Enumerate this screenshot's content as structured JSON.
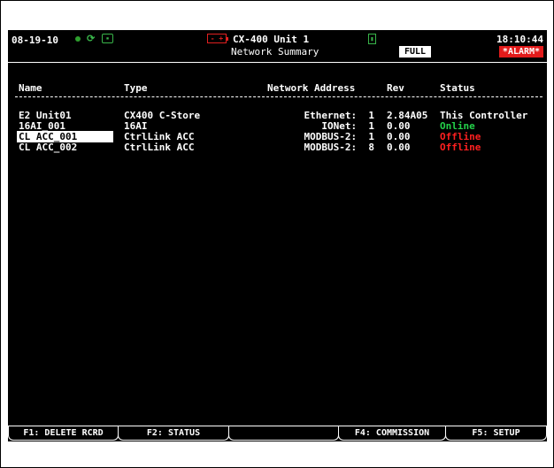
{
  "header": {
    "date": "08-19-10",
    "unit_title": "CX-400 Unit 1",
    "screen_title": "Network Summary",
    "time": "18:10:44",
    "mode_badge": "FULL",
    "alarm_badge": "*ALARM*",
    "icons": [
      "status-dot-icon",
      "network-icon",
      "module-icon",
      "battery-icon",
      "lock-icon"
    ]
  },
  "table": {
    "columns": [
      "Name",
      "Type",
      "Network Address",
      "Rev",
      "Status"
    ],
    "rows": [
      {
        "name": "E2 Unit01",
        "type": "CX400 C-Store",
        "address": "Ethernet:  1",
        "rev": "2.84A05",
        "status": "This Controller",
        "status_kind": "normal",
        "selected": false
      },
      {
        "name": "16AI_001",
        "type": "16AI",
        "address": "IONet:  1",
        "rev": "0.00",
        "status": "Online",
        "status_kind": "online",
        "selected": false
      },
      {
        "name": "CL ACC_001",
        "type": "CtrlLink ACC",
        "address": "MODBUS-2:  1",
        "rev": "0.00",
        "status": "Offline",
        "status_kind": "offline",
        "selected": true
      },
      {
        "name": "CL ACC_002",
        "type": "CtrlLink ACC",
        "address": "MODBUS-2:  8",
        "rev": "0.00",
        "status": "Offline",
        "status_kind": "offline",
        "selected": false
      }
    ]
  },
  "function_keys": [
    {
      "label": "F1: DELETE RCRD"
    },
    {
      "label": "F2: STATUS"
    },
    {
      "label": ""
    },
    {
      "label": "F4: COMMISSION"
    },
    {
      "label": "F5: SETUP"
    }
  ],
  "colors": {
    "background": "#000000",
    "text": "#ffffff",
    "online": "#24d14a",
    "offline": "#ff2020",
    "alarm": "#e21b1b"
  }
}
